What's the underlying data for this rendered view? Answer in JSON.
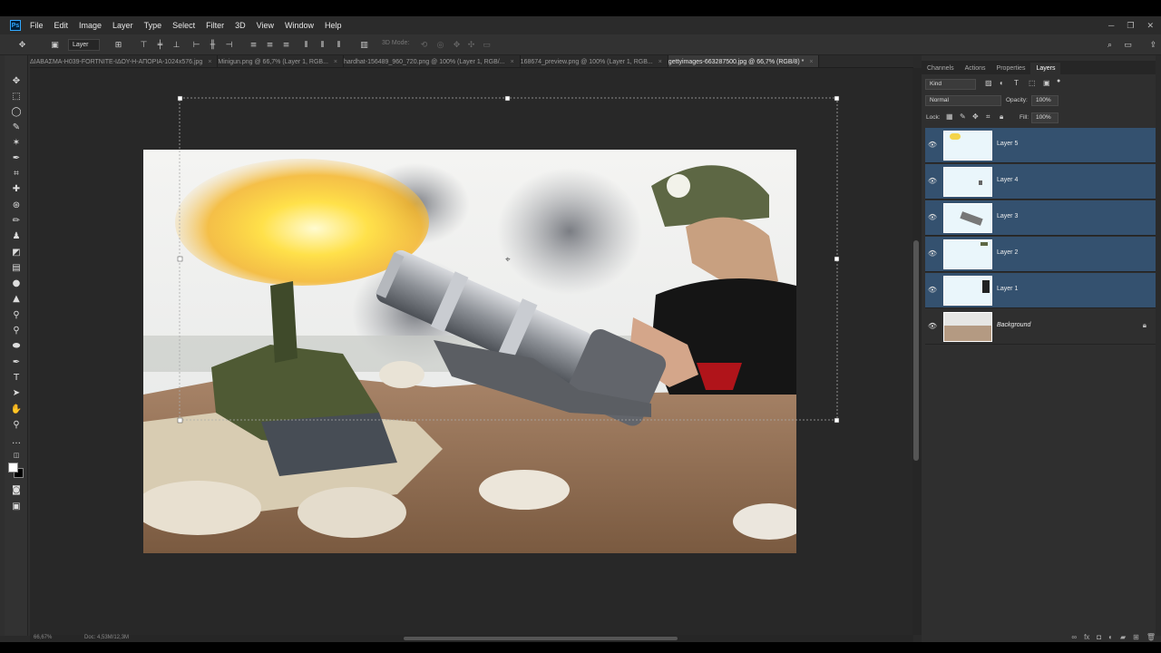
{
  "app": {
    "logo": "Ps"
  },
  "menu": [
    "File",
    "Edit",
    "Image",
    "Layer",
    "Type",
    "Select",
    "Filter",
    "3D",
    "View",
    "Window",
    "Help"
  ],
  "window_controls": {
    "minimize": "─",
    "restore": "❐",
    "close": "✕"
  },
  "options": {
    "auto_select_value": "Layer",
    "mode_3d_label": "3D Mode:"
  },
  "tabs": [
    {
      "label": "ΔΙΑΒΑΣΜΑ-Η039-FORTNITE-ΙΔΟΥ-Η-ΑΠΟΡΙΑ-1024x576.jpg",
      "active": false
    },
    {
      "label": "Minigun.png @ 66,7% (Layer 1, RGB...",
      "active": false
    },
    {
      "label": "hardhat-156489_960_720.png @ 100% (Layer 1, RGB/...",
      "active": false
    },
    {
      "label": "168674_preview.png @ 100% (Layer 1, RGB...",
      "active": false
    },
    {
      "label": "gettyimages-663287500.jpg @ 66,7% (RGB/8) *",
      "active": true
    }
  ],
  "status": {
    "zoom": "66,67%",
    "doc": "Doc: 4,53M/12,3M"
  },
  "panel": {
    "tabs": [
      {
        "label": "Channels",
        "active": false
      },
      {
        "label": "Actions",
        "active": false
      },
      {
        "label": "Properties",
        "active": false
      },
      {
        "label": "Layers",
        "active": true
      }
    ],
    "filter_kind": "Kind",
    "blend_mode": "Normal",
    "opacity_label": "Opacity:",
    "opacity_value": "100%",
    "lock_label": "Lock:",
    "fill_label": "Fill:",
    "fill_value": "100%",
    "layers": [
      {
        "name": "Layer 5",
        "selected": true
      },
      {
        "name": "Layer 4",
        "selected": true
      },
      {
        "name": "Layer 3",
        "selected": true
      },
      {
        "name": "Layer 2",
        "selected": true
      },
      {
        "name": "Layer 1",
        "selected": true
      },
      {
        "name": "Background",
        "selected": false,
        "locked": true
      }
    ]
  },
  "colors": {
    "selected_layer": "#34516f",
    "accent": "#31a8ff"
  }
}
